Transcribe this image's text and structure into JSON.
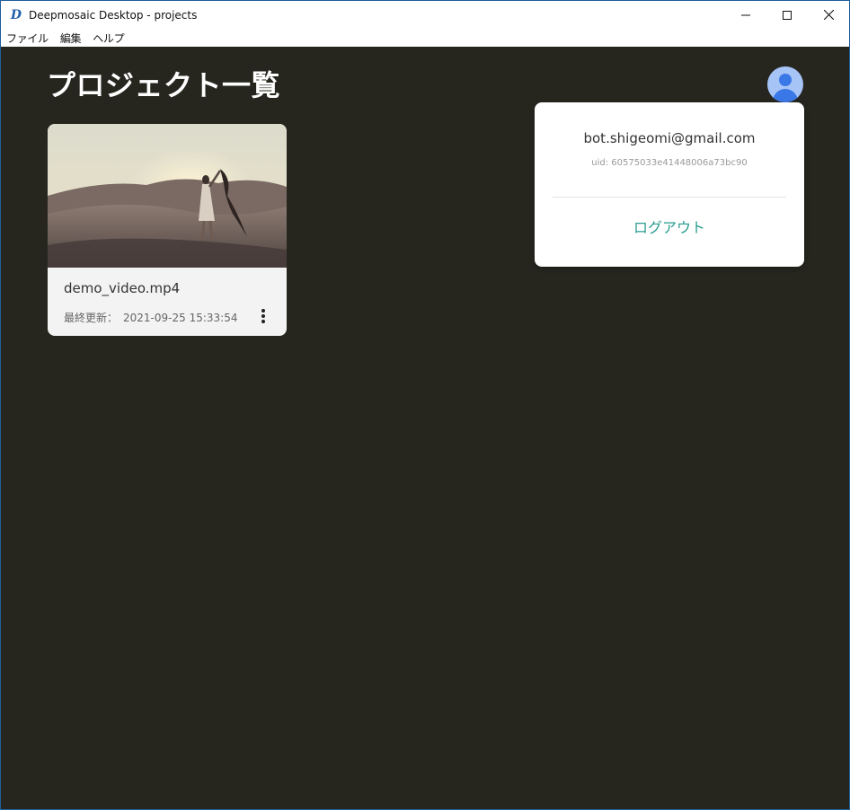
{
  "window": {
    "title": "Deepmosaic Desktop - projects",
    "app_icon_glyph": "D"
  },
  "menu": {
    "items": [
      {
        "label": "ファイル"
      },
      {
        "label": "編集"
      },
      {
        "label": "ヘルプ"
      }
    ]
  },
  "page": {
    "title": "プロジェクト一覧"
  },
  "projects": [
    {
      "name": "demo_video.mp4",
      "updated_label": "最終更新：",
      "updated_value": "2021-09-25 15:33:54",
      "thumbnail_icon": "desert-photo"
    }
  ],
  "account": {
    "email": "bot.shigeomi@gmail.com",
    "uid_text": "uid: 60575033e41448006a73bc90",
    "logout_label": "ログアウト"
  },
  "colors": {
    "background": "#26261f",
    "accent": "#2a9d8f",
    "avatar": "#3b78e7"
  }
}
